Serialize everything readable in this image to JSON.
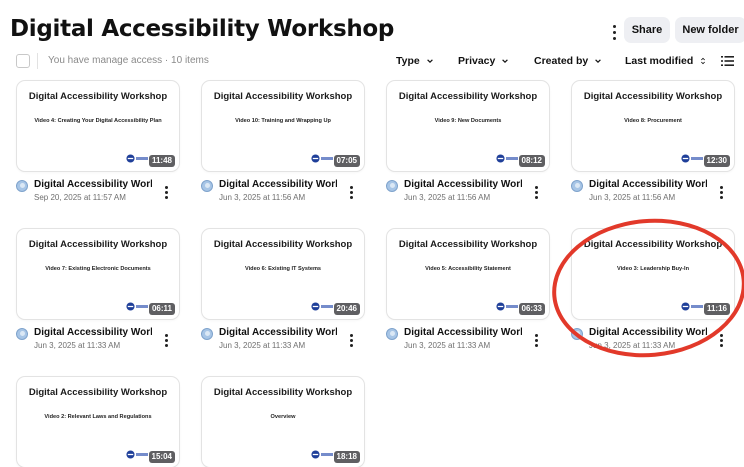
{
  "header": {
    "title": "Digital Accessibility Workshop",
    "share_label": "Share",
    "new_folder_label": "New folder",
    "more_icon": "kebab-icon"
  },
  "toolbar": {
    "access_text": "You have manage access · 10 items",
    "type_label": "Type",
    "privacy_label": "Privacy",
    "created_by_label": "Created by",
    "sort_label": "Last modified"
  },
  "colors": {
    "annotation": "#e2392a",
    "duration_badge": "#5f5f62",
    "button_bg": "#eeeff3"
  },
  "cards": [
    {
      "thumb_title": "Digital Accessibility Workshop",
      "thumb_subtitle": "Video 4: Creating Your Digital Accessibility Plan",
      "duration": "11:48",
      "title": "Digital Accessibility Works...",
      "date": "Sep 20, 2025 at 11:57 AM"
    },
    {
      "thumb_title": "Digital Accessibility Workshop",
      "thumb_subtitle": "Video 10: Training and Wrapping Up",
      "duration": "07:05",
      "title": "Digital Accessibility Works...",
      "date": "Jun 3, 2025 at 11:56 AM"
    },
    {
      "thumb_title": "Digital Accessibility Workshop",
      "thumb_subtitle": "Video 9: New Documents",
      "duration": "08:12",
      "title": "Digital Accessibility Works...",
      "date": "Jun 3, 2025 at 11:56 AM"
    },
    {
      "thumb_title": "Digital Accessibility Workshop",
      "thumb_subtitle": "Video 8: Procurement",
      "duration": "12:30",
      "title": "Digital Accessibility Works...",
      "date": "Jun 3, 2025 at 11:56 AM"
    },
    {
      "thumb_title": "Digital Accessibility Workshop",
      "thumb_subtitle": "Video 7: Existing Electronic Documents",
      "duration": "06:11",
      "title": "Digital Accessibility Works...",
      "date": "Jun 3, 2025 at 11:33 AM"
    },
    {
      "thumb_title": "Digital Accessibility Workshop",
      "thumb_subtitle": "Video 6: Existing IT Systems",
      "duration": "20:46",
      "title": "Digital Accessibility Works...",
      "date": "Jun 3, 2025 at 11:33 AM"
    },
    {
      "thumb_title": "Digital Accessibility Workshop",
      "thumb_subtitle": "Video 5:  Accessibility Statement",
      "duration": "06:33",
      "title": "Digital Accessibility Works...",
      "date": "Jun 3, 2025 at 11:33 AM"
    },
    {
      "thumb_title": "Digital Accessibility Workshop",
      "thumb_subtitle": "Video 3: Leadership Buy-In",
      "duration": "11:16",
      "title": "Digital Accessibility Works...",
      "date": "Jun 3, 2025 at 11:33 AM"
    },
    {
      "thumb_title": "Digital Accessibility Workshop",
      "thumb_subtitle": "Video 2: Relevant Laws and Regulations",
      "duration": "15:04",
      "title": "",
      "date": ""
    },
    {
      "thumb_title": "Digital Accessibility Workshop",
      "thumb_subtitle": "Overview",
      "duration": "18:18",
      "title": "",
      "date": ""
    }
  ]
}
